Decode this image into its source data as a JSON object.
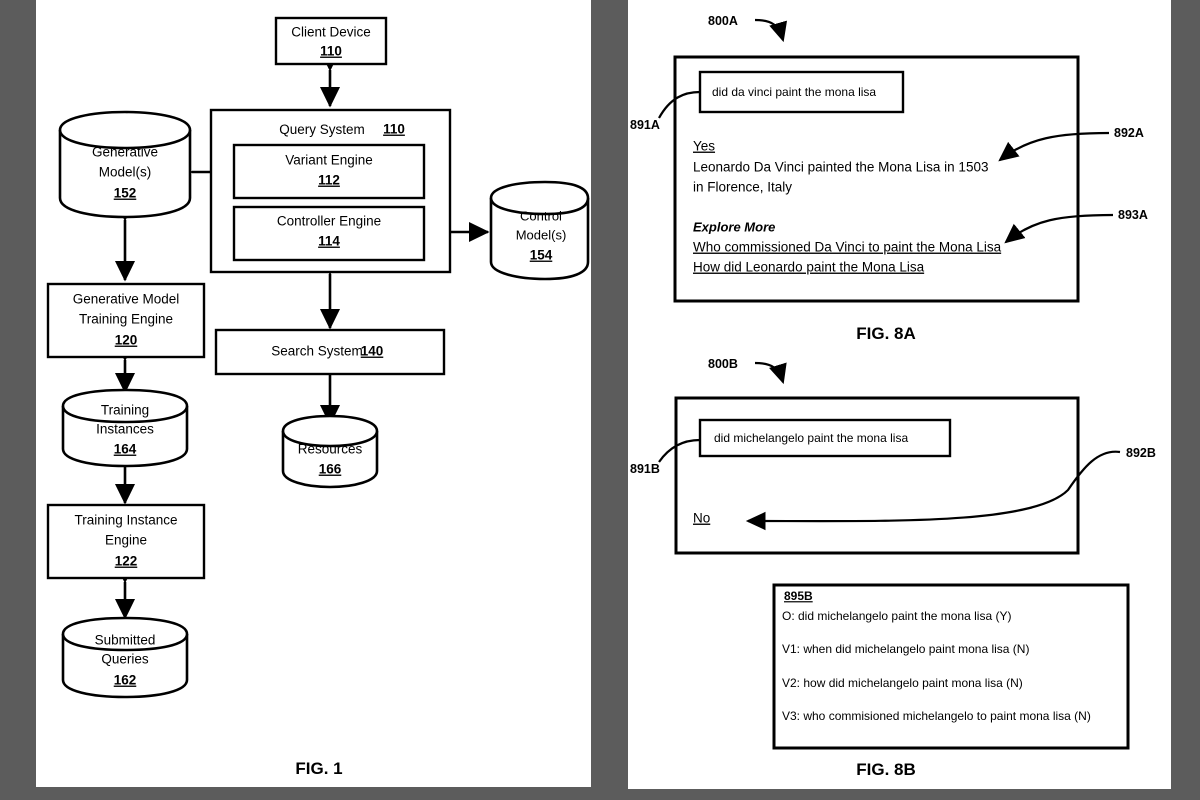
{
  "figures": {
    "fig1": {
      "label": "FIG. 1",
      "nodes": {
        "client_device": {
          "title": "Client Device",
          "ref": "110"
        },
        "query_system": {
          "title": "Query System",
          "ref": "110"
        },
        "variant_engine": {
          "title": "Variant Engine",
          "ref": "112"
        },
        "controller_engine": {
          "title": "Controller Engine",
          "ref": "114"
        },
        "generative_models": {
          "line1": "Generative",
          "line2": "Model(s)",
          "ref": "152"
        },
        "control_models": {
          "line1": "Control",
          "line2": "Model(s)",
          "ref": "154"
        },
        "generative_model_training_engine": {
          "line1": "Generative Model",
          "line2": "Training Engine",
          "ref": "120"
        },
        "training_instances": {
          "line1": "Training",
          "line2": "Instances",
          "ref": "164"
        },
        "training_instance_engine": {
          "line1": "Training Instance",
          "line2": "Engine",
          "ref": "122"
        },
        "submitted_queries": {
          "line1": "Submitted",
          "line2": "Queries",
          "ref": "162"
        },
        "search_system": {
          "title": "Search System",
          "ref": "140"
        },
        "resources": {
          "line1": "Resources",
          "ref": "166"
        }
      }
    },
    "fig8a": {
      "label": "FIG. 8A",
      "callouts": {
        "screen": "800A",
        "query": "891A",
        "answer": "892A",
        "explore": "893A"
      },
      "query_text": "did da vinci paint the mona lisa",
      "answer": {
        "verdict": "Yes",
        "line1": "Leonardo Da Vinci painted the Mona Lisa in 1503",
        "line2": "in Florence, Italy"
      },
      "explore": {
        "heading": "Explore More",
        "links": [
          "Who commissioned Da Vinci to paint the Mona Lisa",
          "How did Leonardo paint the Mona Lisa"
        ]
      }
    },
    "fig8b": {
      "label": "FIG. 8B",
      "callouts": {
        "screen": "800B",
        "query": "891B",
        "answer": "892B"
      },
      "query_text": "did michelangelo paint the mona lisa",
      "answer": {
        "verdict": "No"
      },
      "variants_box": {
        "ref": "895B",
        "lines": [
          "O: did michelangelo paint the mona lisa (Y)",
          "V1: when did michelangelo paint mona lisa (N)",
          "V2: how did michelangelo paint mona lisa (N)",
          "V3: who commisioned michelangelo to paint mona lisa (N)"
        ]
      }
    }
  }
}
